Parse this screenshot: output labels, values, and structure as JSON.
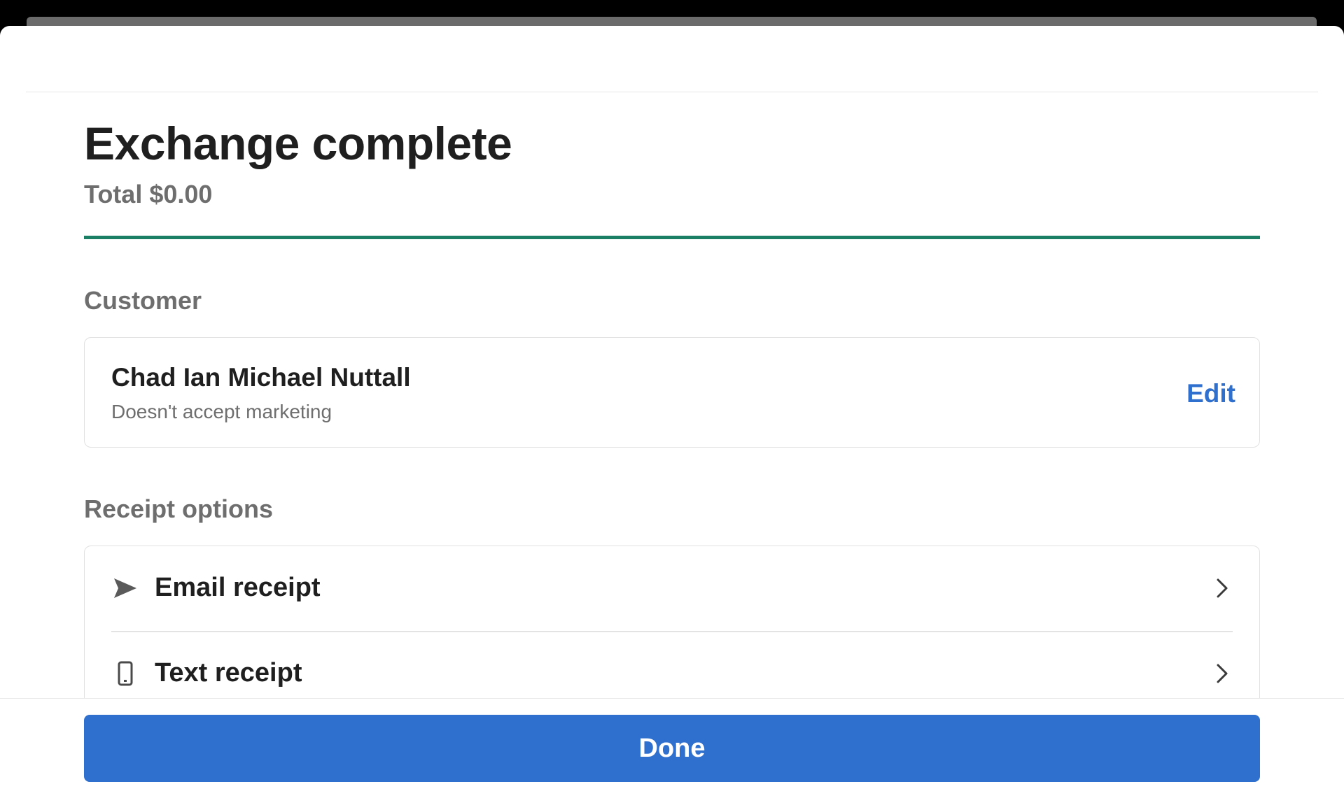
{
  "header": {
    "title": "Exchange complete",
    "total": "Total $0.00",
    "progress_fraction": 1.0,
    "accent_color": "#1a7f64"
  },
  "customer": {
    "section_label": "Customer",
    "name": "Chad Ian Michael Nuttall",
    "marketing_status": "Doesn't accept marketing",
    "edit_label": "Edit"
  },
  "receipt": {
    "section_label": "Receipt options",
    "options": [
      {
        "label": "Email receipt",
        "icon": "send-icon"
      },
      {
        "label": "Text receipt",
        "icon": "phone-icon"
      }
    ]
  },
  "footer": {
    "done_label": "Done",
    "button_color": "#2f6fcd"
  }
}
